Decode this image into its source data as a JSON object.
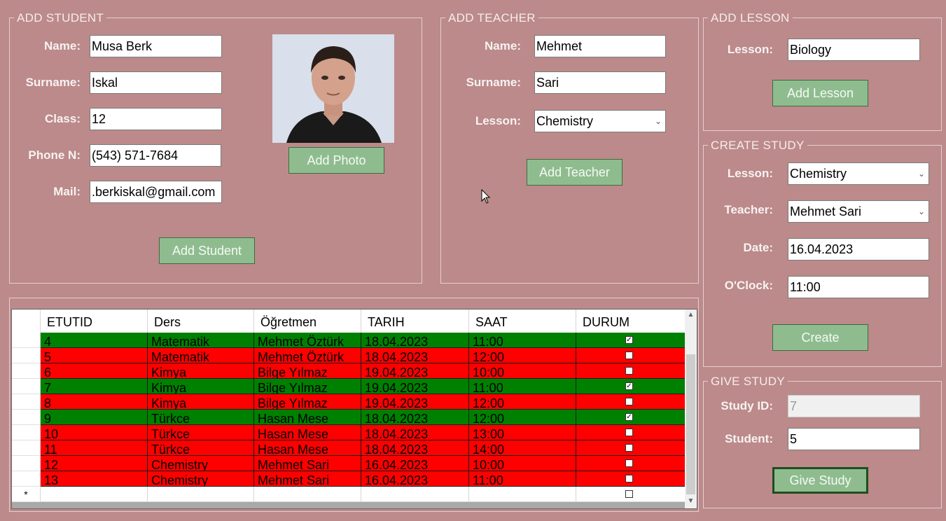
{
  "add_student": {
    "legend": "ADD STUDENT",
    "name_label": "Name:",
    "name_value": "Musa Berk",
    "surname_label": "Surname:",
    "surname_value": "Iskal",
    "class_label": "Class:",
    "class_value": "12",
    "phone_label": "Phone N:",
    "phone_value": "(543) 571-7684",
    "mail_label": "Mail:",
    "mail_value": ".berkiskal@gmail.com",
    "add_photo_button": "Add Photo",
    "add_student_button": "Add Student"
  },
  "add_teacher": {
    "legend": "ADD TEACHER",
    "name_label": "Name:",
    "name_value": "Mehmet",
    "surname_label": "Surname:",
    "surname_value": "Sari",
    "lesson_label": "Lesson:",
    "lesson_value": "Chemistry",
    "add_teacher_button": "Add Teacher"
  },
  "add_lesson": {
    "legend": "ADD LESSON",
    "lesson_label": "Lesson:",
    "lesson_value": "Biology",
    "add_lesson_button": "Add Lesson"
  },
  "create_study": {
    "legend": "CREATE STUDY",
    "lesson_label": "Lesson:",
    "lesson_value": "Chemistry",
    "teacher_label": "Teacher:",
    "teacher_value": "Mehmet Sari",
    "date_label": "Date:",
    "date_value": "16.04.2023",
    "oclock_label": "O'Clock:",
    "oclock_value": "11:00",
    "create_button": "Create"
  },
  "give_study": {
    "legend": "GIVE STUDY",
    "study_id_label": "Study ID:",
    "study_id_value": "7",
    "student_label": "Student:",
    "student_value": "5",
    "give_study_button": "Give Study"
  },
  "grid": {
    "columns": [
      "ETUTID",
      "Ders",
      "Öğretmen",
      "TARIH",
      "SAAT",
      "DURUM"
    ],
    "new_row_marker": "*",
    "rows": [
      {
        "id": "4",
        "ders": "Matematik",
        "ogretmen": "Mehmet Öztürk",
        "tarih": "18.04.2023",
        "saat": "11:00",
        "durum": true
      },
      {
        "id": "5",
        "ders": "Matematik",
        "ogretmen": "Mehmet Öztürk",
        "tarih": "18.04.2023",
        "saat": "12:00",
        "durum": false
      },
      {
        "id": "6",
        "ders": "Kimya",
        "ogretmen": "Bilge Yılmaz",
        "tarih": "19.04.2023",
        "saat": "10:00",
        "durum": false
      },
      {
        "id": "7",
        "ders": "Kimya",
        "ogretmen": "Bilge Yılmaz",
        "tarih": "19.04.2023",
        "saat": "11:00",
        "durum": true
      },
      {
        "id": "8",
        "ders": "Kimya",
        "ogretmen": "Bilge Yılmaz",
        "tarih": "19.04.2023",
        "saat": "12:00",
        "durum": false
      },
      {
        "id": "9",
        "ders": "Türkce",
        "ogretmen": "Hasan Mese",
        "tarih": "18.04.2023",
        "saat": "12:00",
        "durum": true
      },
      {
        "id": "10",
        "ders": "Türkce",
        "ogretmen": "Hasan Mese",
        "tarih": "18.04.2023",
        "saat": "13:00",
        "durum": false
      },
      {
        "id": "11",
        "ders": "Türkce",
        "ogretmen": "Hasan Mese",
        "tarih": "18.04.2023",
        "saat": "14:00",
        "durum": false
      },
      {
        "id": "12",
        "ders": "Chemistry",
        "ogretmen": "Mehmet Sari",
        "tarih": "16.04.2023",
        "saat": "10:00",
        "durum": false
      },
      {
        "id": "13",
        "ders": "Chemistry",
        "ogretmen": "Mehmet Sari",
        "tarih": "16.04.2023",
        "saat": "11:00",
        "durum": false
      }
    ]
  },
  "colors": {
    "background": "#bc8a8a",
    "button": "#8fbc8f",
    "row_done": "#008000",
    "row_pending": "#ff0000"
  }
}
